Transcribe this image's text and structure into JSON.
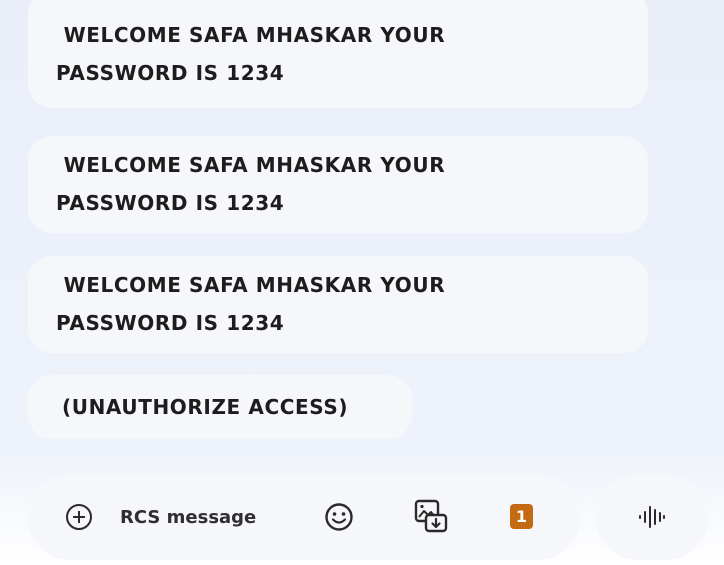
{
  "messages": [
    {
      "text": " WELCOME SAFA MHASKAR YOUR\nPASSWORD IS 1234"
    },
    {
      "text": " WELCOME SAFA MHASKAR YOUR\nPASSWORD IS 1234"
    },
    {
      "text": " WELCOME SAFA MHASKAR YOUR\nPASSWORD IS 1234"
    },
    {
      "text": "(UNAUTHORIZE ACCESS)"
    }
  ],
  "composer": {
    "placeholder": "RCS message",
    "add_icon": "add-circle-icon",
    "emoji_icon": "emoji-icon",
    "gallery_icon": "gallery-icon",
    "sim_badge": "1",
    "sim_badge_color": "#c46a12",
    "voice_icon": "voice-waveform-icon"
  }
}
